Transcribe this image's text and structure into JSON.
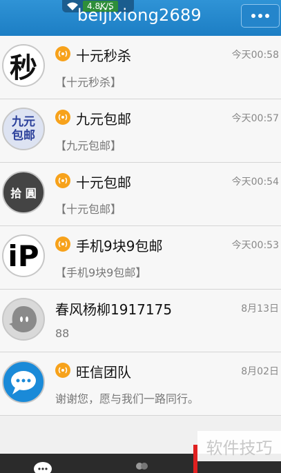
{
  "status_bar": {
    "speed": "4.8K/S"
  },
  "header": {
    "title": "beijixiong2689",
    "more_icon": "more-dots-icon"
  },
  "conversations": [
    {
      "name": "十元秒杀",
      "time": "今天00:58",
      "preview": "【十元秒杀】",
      "avatar_text": "秒",
      "official": true
    },
    {
      "name": "九元包邮",
      "time": "今天00:57",
      "preview": "【九元包邮】",
      "avatar_text": "九元包邮",
      "official": true
    },
    {
      "name": "十元包邮",
      "time": "今天00:54",
      "preview": "【十元包邮】",
      "avatar_text": "拾 圓",
      "official": true
    },
    {
      "name": "手机9块9包邮",
      "time": "今天00:53",
      "preview": "【手机9块9包邮】",
      "avatar_text": "iP",
      "official": true
    },
    {
      "name": "春风杨柳1917175",
      "time": "8月13日",
      "preview": "88",
      "avatar_text": "",
      "official": false
    },
    {
      "name": "旺信团队",
      "time": "8月02日",
      "preview": "谢谢您，愿与我们一路同行。",
      "avatar_text": "",
      "official": true
    }
  ],
  "watermark": "软件技巧",
  "colors": {
    "header": "#1f86cc",
    "badge": "#f7a21b",
    "tabbar": "#2b2b2b"
  }
}
